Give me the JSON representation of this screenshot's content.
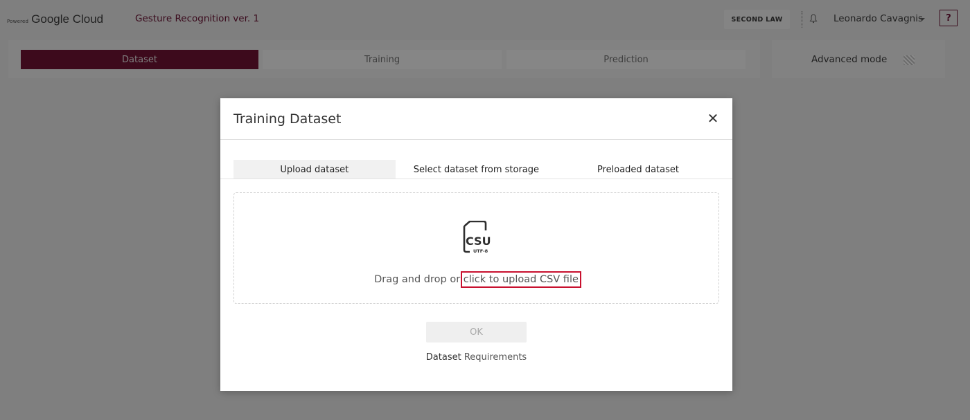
{
  "header": {
    "brand_small": "Powered",
    "brand": "Google Cloud",
    "project_title": "Gesture Recognition ver. 1",
    "org_button": "SECOND LAW",
    "user_name": "Leonardo Cavagnis",
    "help_label": "?"
  },
  "steps": [
    {
      "label": "Dataset",
      "active": true
    },
    {
      "label": "Training",
      "active": false
    },
    {
      "label": "Prediction",
      "active": false
    }
  ],
  "advanced": {
    "label": "Advanced mode",
    "enabled": false
  },
  "modal": {
    "title": "Training Dataset",
    "close_glyph": "✕",
    "tabs": [
      {
        "label": "Upload dataset",
        "active": true
      },
      {
        "label": "Select dataset from storage",
        "active": false
      },
      {
        "label": "Preloaded dataset",
        "active": false
      }
    ],
    "dropzone": {
      "icon_text": "CSU",
      "icon_subtext": "UTF-8",
      "text": "Drag and drop or ",
      "link": "click to upload CSV file"
    },
    "ok_label": "OK",
    "requirements_prefix": "Dataset ",
    "requirements_link": "Requirements"
  },
  "colors": {
    "overlay_bg": "#7f7f7f",
    "brand_accent": "#7b1538",
    "highlight_box": "#c8102e"
  }
}
